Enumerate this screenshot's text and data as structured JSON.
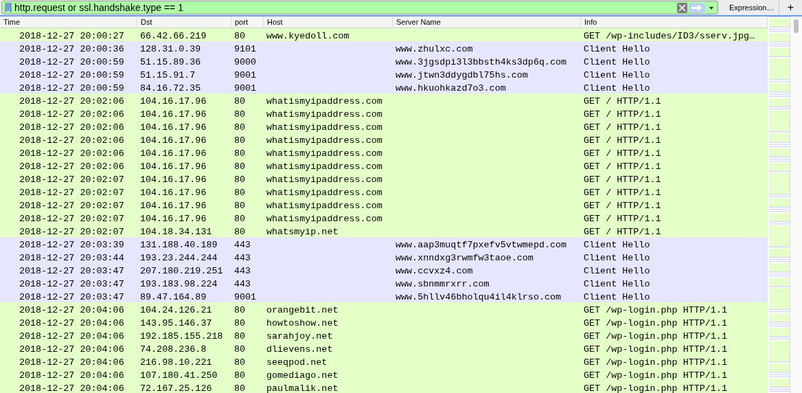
{
  "filter": {
    "value": "http.request or ssl.handshake.type == 1",
    "expression_button": "Expression…",
    "add_button": "+"
  },
  "table": {
    "columns": [
      "Time",
      "Dst",
      "port",
      "Host",
      "Server Name",
      "Info"
    ],
    "rows": [
      {
        "kind": "http",
        "time": "2018-12-27 20:00:27",
        "dst": "66.42.66.219",
        "port": "80",
        "host": "www.kyedoll.com",
        "info": "GET /wp-includes/ID3/sserv.jpg…"
      },
      {
        "kind": "tls",
        "time": "2018-12-27 20:00:36",
        "dst": "128.31.0.39",
        "port": "9101",
        "server": "www.zhulxc.com",
        "info": "Client Hello"
      },
      {
        "kind": "tls",
        "time": "2018-12-27 20:00:59",
        "dst": "51.15.89.36",
        "port": "9000",
        "server": "www.3jgsdpi3l3bbsth4ks3dp6q.com",
        "info": "Client Hello"
      },
      {
        "kind": "tls",
        "time": "2018-12-27 20:00:59",
        "dst": "51.15.91.7",
        "port": "9001",
        "server": "www.jtwn3ddygdbl75hs.com",
        "info": "Client Hello"
      },
      {
        "kind": "tls",
        "time": "2018-12-27 20:00:59",
        "dst": "84.16.72.35",
        "port": "9001",
        "server": "www.hkuohkazd7o3.com",
        "info": "Client Hello"
      },
      {
        "kind": "http",
        "time": "2018-12-27 20:02:06",
        "dst": "104.16.17.96",
        "port": "80",
        "host": "whatismyipaddress.com",
        "info": "GET / HTTP/1.1"
      },
      {
        "kind": "http",
        "time": "2018-12-27 20:02:06",
        "dst": "104.16.17.96",
        "port": "80",
        "host": "whatismyipaddress.com",
        "info": "GET / HTTP/1.1"
      },
      {
        "kind": "http",
        "time": "2018-12-27 20:02:06",
        "dst": "104.16.17.96",
        "port": "80",
        "host": "whatismyipaddress.com",
        "info": "GET / HTTP/1.1"
      },
      {
        "kind": "http",
        "time": "2018-12-27 20:02:06",
        "dst": "104.16.17.96",
        "port": "80",
        "host": "whatismyipaddress.com",
        "info": "GET / HTTP/1.1"
      },
      {
        "kind": "http",
        "time": "2018-12-27 20:02:06",
        "dst": "104.16.17.96",
        "port": "80",
        "host": "whatismyipaddress.com",
        "info": "GET / HTTP/1.1"
      },
      {
        "kind": "http",
        "time": "2018-12-27 20:02:06",
        "dst": "104.16.17.96",
        "port": "80",
        "host": "whatismyipaddress.com",
        "info": "GET / HTTP/1.1"
      },
      {
        "kind": "http",
        "time": "2018-12-27 20:02:07",
        "dst": "104.16.17.96",
        "port": "80",
        "host": "whatismyipaddress.com",
        "info": "GET / HTTP/1.1"
      },
      {
        "kind": "http",
        "time": "2018-12-27 20:02:07",
        "dst": "104.16.17.96",
        "port": "80",
        "host": "whatismyipaddress.com",
        "info": "GET / HTTP/1.1"
      },
      {
        "kind": "http",
        "time": "2018-12-27 20:02:07",
        "dst": "104.16.17.96",
        "port": "80",
        "host": "whatismyipaddress.com",
        "info": "GET / HTTP/1.1"
      },
      {
        "kind": "http",
        "time": "2018-12-27 20:02:07",
        "dst": "104.16.17.96",
        "port": "80",
        "host": "whatismyipaddress.com",
        "info": "GET / HTTP/1.1"
      },
      {
        "kind": "http",
        "time": "2018-12-27 20:02:07",
        "dst": "104.18.34.131",
        "port": "80",
        "host": "whatsmyip.net",
        "info": "GET / HTTP/1.1"
      },
      {
        "kind": "tls",
        "time": "2018-12-27 20:03:39",
        "dst": "131.188.40.189",
        "port": "443",
        "server": "www.aap3muqtf7pxefv5vtwmepd.com",
        "info": "Client Hello"
      },
      {
        "kind": "tls",
        "time": "2018-12-27 20:03:44",
        "dst": "193.23.244.244",
        "port": "443",
        "server": "www.xnndxg3rwmfw3taoe.com",
        "info": "Client Hello"
      },
      {
        "kind": "tls",
        "time": "2018-12-27 20:03:47",
        "dst": "207.180.219.251",
        "port": "443",
        "server": "www.ccvxz4.com",
        "info": "Client Hello"
      },
      {
        "kind": "tls",
        "time": "2018-12-27 20:03:47",
        "dst": "193.183.98.224",
        "port": "443",
        "server": "www.sbnmmrxrr.com",
        "info": "Client Hello"
      },
      {
        "kind": "tls",
        "time": "2018-12-27 20:03:47",
        "dst": "89.47.164.89",
        "port": "9001",
        "server": "www.5hllv46bholqu4il4klrso.com",
        "info": "Client Hello"
      },
      {
        "kind": "http",
        "time": "2018-12-27 20:04:06",
        "dst": "104.24.126.21",
        "port": "80",
        "host": "orangebit.net",
        "info": "GET /wp-login.php HTTP/1.1"
      },
      {
        "kind": "http",
        "time": "2018-12-27 20:04:06",
        "dst": "143.95.146.37",
        "port": "80",
        "host": "howtoshow.net",
        "info": "GET /wp-login.php HTTP/1.1"
      },
      {
        "kind": "http",
        "time": "2018-12-27 20:04:06",
        "dst": "192.185.155.218",
        "port": "80",
        "host": "sarahjoy.net",
        "info": "GET /wp-login.php HTTP/1.1"
      },
      {
        "kind": "http",
        "time": "2018-12-27 20:04:06",
        "dst": "74.208.236.8",
        "port": "80",
        "host": "dlievens.net",
        "info": "GET /wp-login.php HTTP/1.1"
      },
      {
        "kind": "http",
        "time": "2018-12-27 20:04:06",
        "dst": "216.98.10.221",
        "port": "80",
        "host": "seeqpod.net",
        "info": "GET /wp-login.php HTTP/1.1"
      },
      {
        "kind": "http",
        "time": "2018-12-27 20:04:06",
        "dst": "107.180.41.250",
        "port": "80",
        "host": "gomediago.net",
        "info": "GET /wp-login.php HTTP/1.1"
      },
      {
        "kind": "http",
        "time": "2018-12-27 20:04:06",
        "dst": "72.167.25.126",
        "port": "80",
        "host": "paulmalik.net",
        "info": "GET /wp-login.php HTTP/1.1"
      }
    ]
  }
}
